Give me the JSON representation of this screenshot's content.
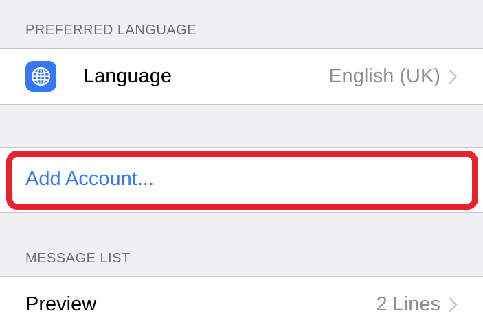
{
  "preferred_language": {
    "header": "PREFERRED LANGUAGE",
    "language_row": {
      "label": "Language",
      "value": "English (UK)",
      "icon": "globe-icon",
      "icon_color": "#3478f6"
    }
  },
  "account": {
    "add_account_label": "Add Account..."
  },
  "message_list": {
    "header": "MESSAGE LIST",
    "preview_row": {
      "label": "Preview",
      "value": "2 Lines"
    }
  },
  "colors": {
    "accent": "#3478f6",
    "highlight": "#e8222c",
    "background": "#efeff4"
  }
}
